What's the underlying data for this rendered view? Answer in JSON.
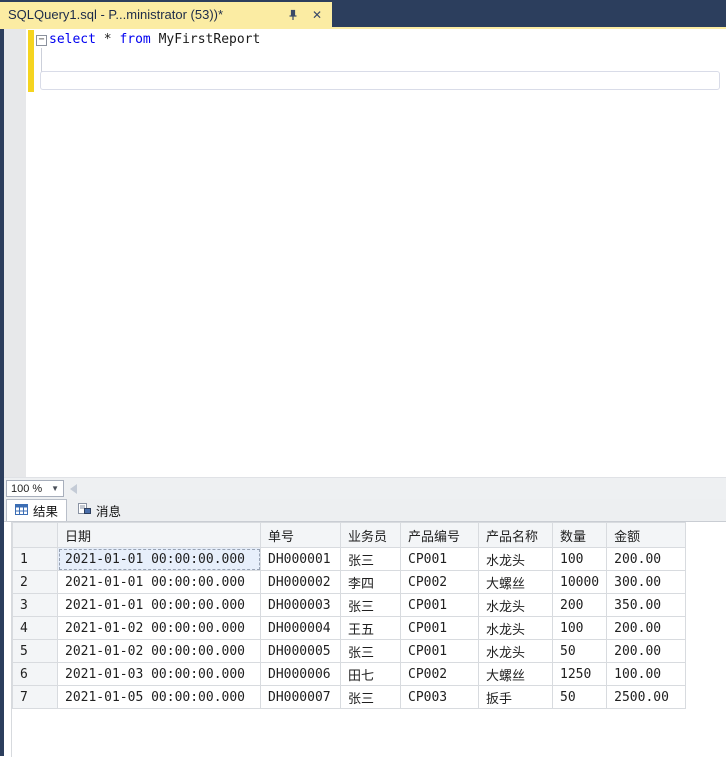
{
  "window": {
    "tab_title": "SQLQuery1.sql - P...ministrator (53))*"
  },
  "icons": {
    "collapse_minus": "−",
    "close": "✕",
    "combo_caret": "▼"
  },
  "editor": {
    "code_tokens": [
      {
        "text": "select",
        "type": "keyword"
      },
      {
        "text": " * ",
        "type": "plain"
      },
      {
        "text": "from",
        "type": "keyword"
      },
      {
        "text": " MyFirstReport",
        "type": "plain"
      }
    ]
  },
  "status_bar": {
    "zoom_level": "100 %"
  },
  "results_pane": {
    "tabs": [
      {
        "label": "结果",
        "active": true
      },
      {
        "label": "消息",
        "active": false
      }
    ]
  },
  "grid": {
    "columns": [
      "日期",
      "单号",
      "业务员",
      "产品编号",
      "产品名称",
      "数量",
      "金额"
    ],
    "rows": [
      {
        "num": "1",
        "cells": [
          "2021-01-01 00:00:00.000",
          "DH000001",
          "张三",
          "CP001",
          "水龙头",
          "100",
          "200.00"
        ]
      },
      {
        "num": "2",
        "cells": [
          "2021-01-01 00:00:00.000",
          "DH000002",
          "李四",
          "CP002",
          "大螺丝",
          "10000",
          "300.00"
        ]
      },
      {
        "num": "3",
        "cells": [
          "2021-01-01 00:00:00.000",
          "DH000003",
          "张三",
          "CP001",
          "水龙头",
          "200",
          "350.00"
        ]
      },
      {
        "num": "4",
        "cells": [
          "2021-01-02 00:00:00.000",
          "DH000004",
          "王五",
          "CP001",
          "水龙头",
          "100",
          "200.00"
        ]
      },
      {
        "num": "5",
        "cells": [
          "2021-01-02 00:00:00.000",
          "DH000005",
          "张三",
          "CP001",
          "水龙头",
          "50",
          "200.00"
        ]
      },
      {
        "num": "6",
        "cells": [
          "2021-01-03 00:00:00.000",
          "DH000006",
          "田七",
          "CP002",
          "大螺丝",
          "1250",
          "100.00"
        ]
      },
      {
        "num": "7",
        "cells": [
          "2021-01-05 00:00:00.000",
          "DH000007",
          "张三",
          "CP003",
          "扳手",
          "50",
          "2500.00"
        ]
      }
    ],
    "selected_cell": {
      "row": 0,
      "col": 0
    }
  },
  "colors": {
    "accent_navy": "#2c3e5d",
    "tab_yellow": "#fbeca3",
    "keyword_blue": "#0000f0",
    "modified_bar_yellow": "#f5d41f",
    "selected_cell_bg": "#e7effb"
  }
}
